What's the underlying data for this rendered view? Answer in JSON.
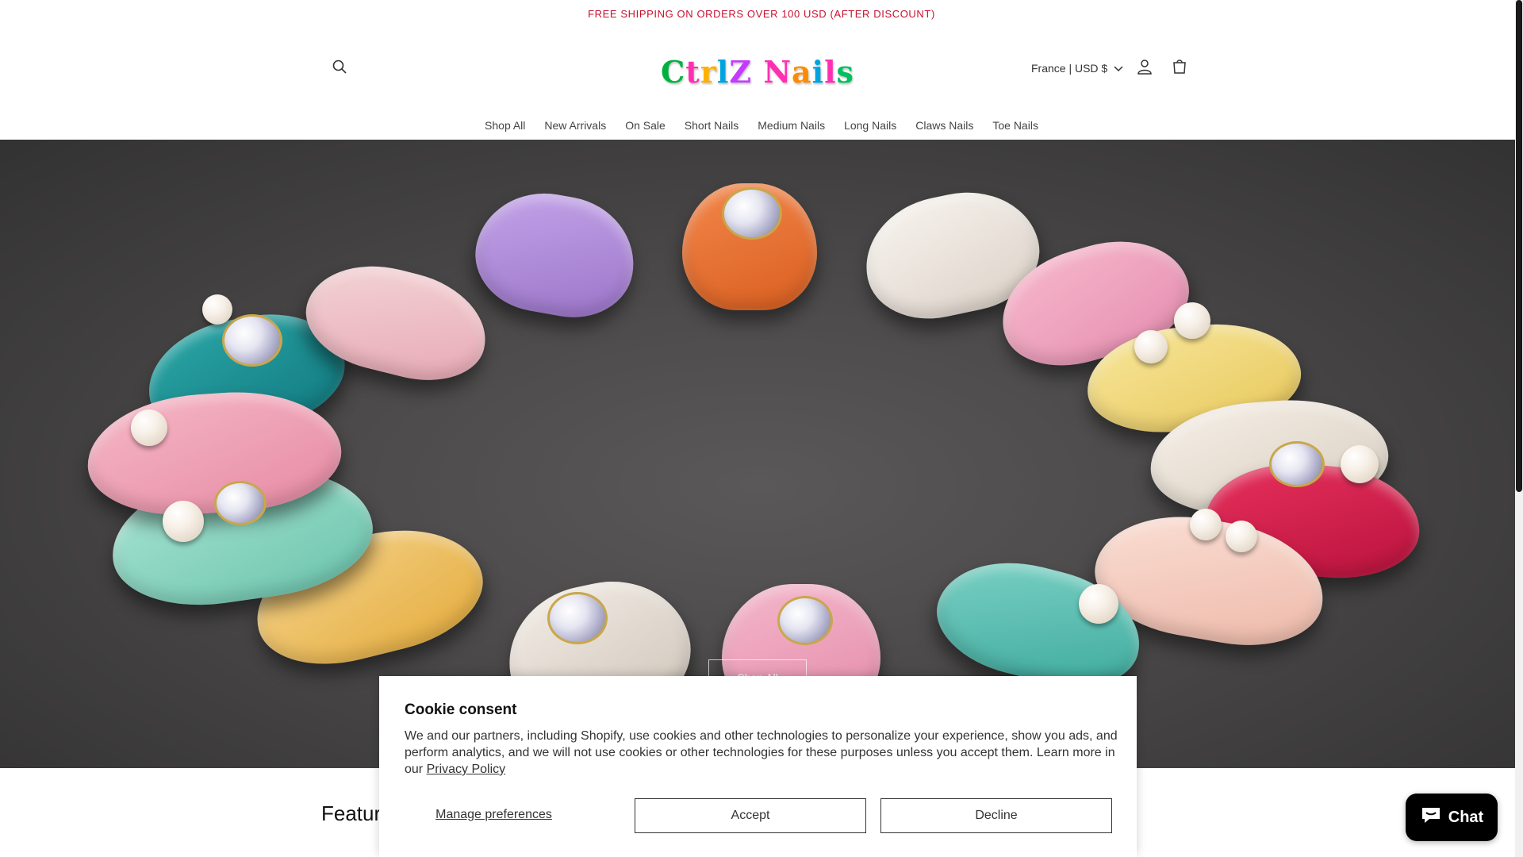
{
  "announcement": {
    "text": "FREE SHIPPING ON ORDERS OVER 100 USD (AFTER DISCOUNT)",
    "color": "#c8102e"
  },
  "header": {
    "search_icon": "search-icon",
    "logo": {
      "text": "CtrlZ Nails",
      "letters": [
        {
          "ch": "C",
          "color": "#00b140"
        },
        {
          "ch": "t",
          "color": "#ff2fb4"
        },
        {
          "ch": "r",
          "color": "#ffb000"
        },
        {
          "ch": "l",
          "color": "#00a3e0"
        },
        {
          "ch": "Z",
          "color": "#c43bff"
        },
        {
          "ch": " ",
          "color": "#000000"
        },
        {
          "ch": "N",
          "color": "#ff2fb4"
        },
        {
          "ch": "a",
          "color": "#ff8a00"
        },
        {
          "ch": "i",
          "color": "#00a3e0"
        },
        {
          "ch": "l",
          "color": "#ff2fb4"
        },
        {
          "ch": "s",
          "color": "#00c060"
        }
      ]
    },
    "locale": "France | USD $",
    "account_icon": "account-icon",
    "cart_icon": "cart-icon"
  },
  "nav": {
    "items": [
      "Shop All",
      "New Arrivals",
      "On Sale",
      "Short Nails",
      "Medium Nails",
      "Long Nails",
      "Claws Nails",
      "Toe Nails"
    ]
  },
  "hero": {
    "button_label": "Shop All"
  },
  "featured": {
    "title": "Featured"
  },
  "cookie": {
    "title": "Cookie consent",
    "body": "We and our partners, including Shopify, use cookies and other technologies to personalize your experience, show you ads, and perform analytics, and we will not use cookies or other technologies for these purposes unless you accept them. Learn more in our",
    "privacy_link": "Privacy Policy",
    "manage_label": "Manage preferences",
    "accept_label": "Accept",
    "decline_label": "Decline"
  },
  "chat": {
    "label": "Chat",
    "icon": "chat-bubble-icon"
  }
}
